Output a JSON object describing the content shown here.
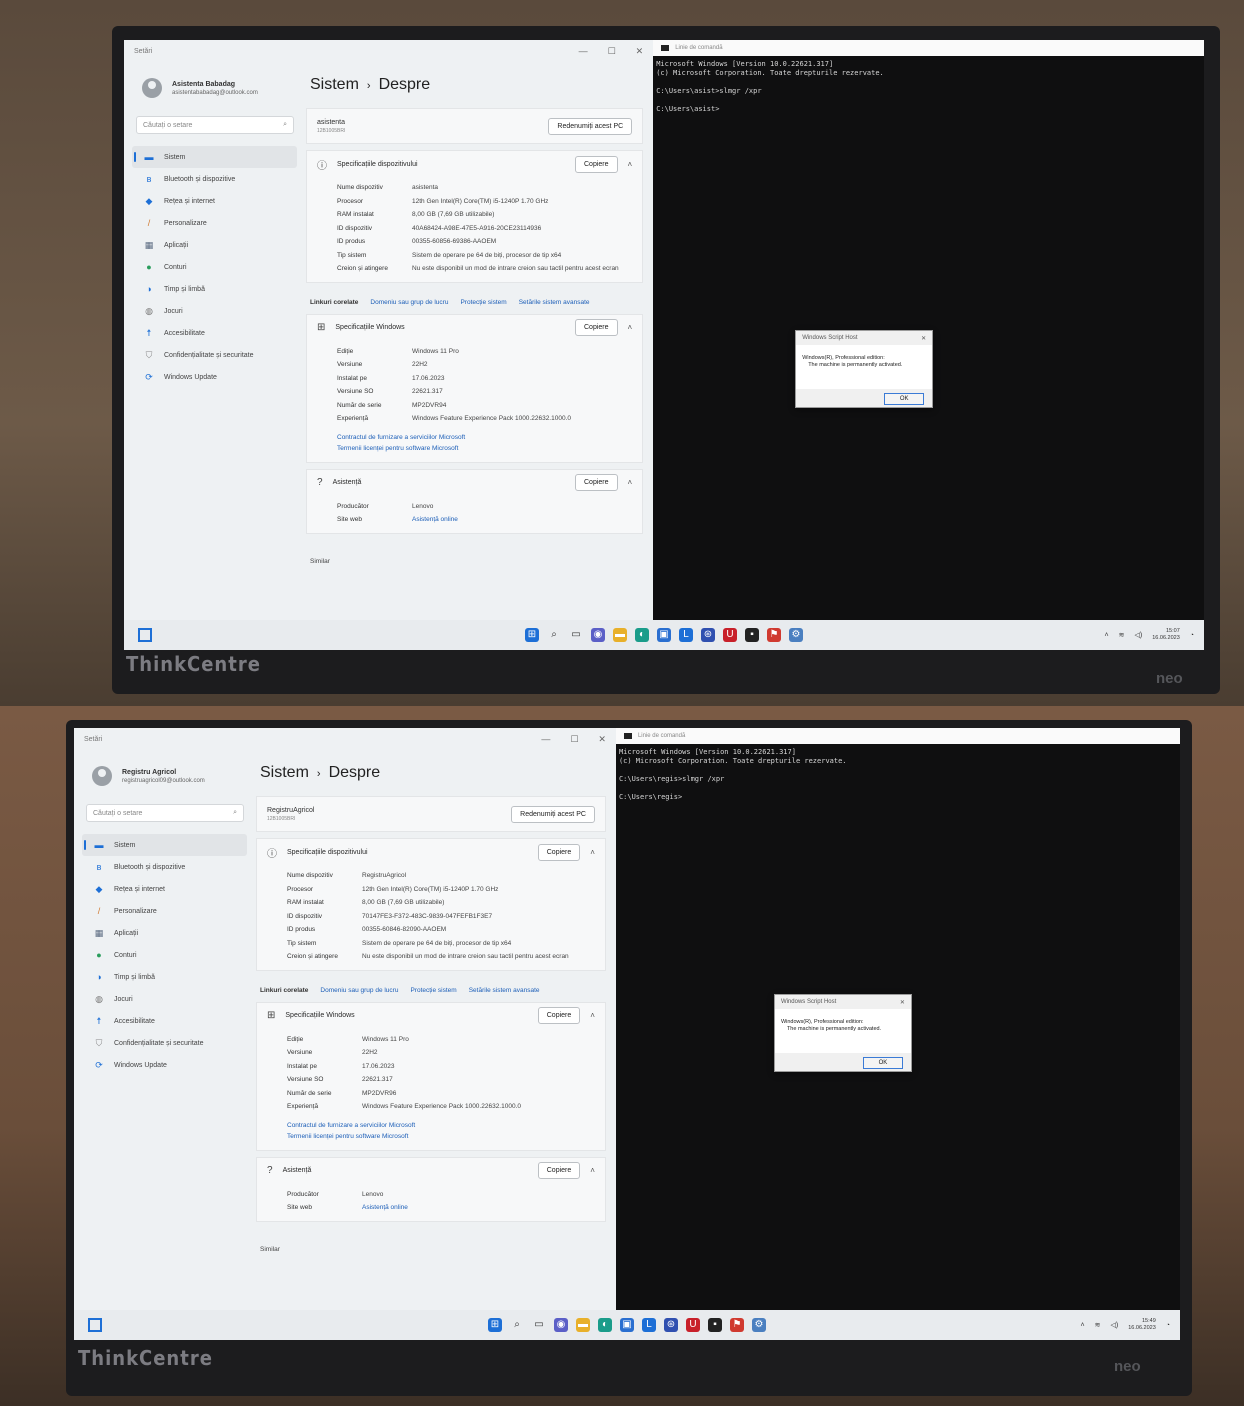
{
  "shots": [
    {
      "id": "top",
      "brand": "ThinkCentre",
      "neo": "neo",
      "settings": {
        "window_title": "Setări",
        "user_name": "Asistenta Babadag",
        "user_email": "asistentababadag@outlook.com",
        "search_placeholder": "Căutați o setare",
        "nav": [
          {
            "label": "Sistem",
            "icon": "monitor-icon",
            "selected": true
          },
          {
            "label": "Bluetooth și dispozitive",
            "icon": "bluetooth-icon"
          },
          {
            "label": "Rețea și internet",
            "icon": "wifi-icon"
          },
          {
            "label": "Personalizare",
            "icon": "brush-icon"
          },
          {
            "label": "Aplicații",
            "icon": "apps-icon"
          },
          {
            "label": "Conturi",
            "icon": "person-icon"
          },
          {
            "label": "Timp și limbă",
            "icon": "globe-icon"
          },
          {
            "label": "Jocuri",
            "icon": "gamepad-icon"
          },
          {
            "label": "Accesibilitate",
            "icon": "accessibility-icon"
          },
          {
            "label": "Confidențialitate și securitate",
            "icon": "shield-icon"
          },
          {
            "label": "Windows Update",
            "icon": "update-icon"
          }
        ],
        "breadcrumb_parent": "Sistem",
        "breadcrumb_current": "Despre",
        "pc_name": "asistenta",
        "pc_model": "12B1005BRI",
        "rename_button": "Redenumiți acest PC",
        "device_specs_title": "Specificațiile dispozitivului",
        "copy_label": "Copiere",
        "device_specs": [
          {
            "k": "Nume dispozitiv",
            "v": "asistenta"
          },
          {
            "k": "Procesor",
            "v": "12th Gen Intel(R) Core(TM) i5-1240P   1.70 GHz"
          },
          {
            "k": "RAM instalat",
            "v": "8,00 GB (7,69 GB utilizabile)"
          },
          {
            "k": "ID dispozitiv",
            "v": "40A68424-A98E-47E5-A916-20CE23114936"
          },
          {
            "k": "ID produs",
            "v": "00355-60856-69386-AAOEM"
          },
          {
            "k": "Tip sistem",
            "v": "Sistem de operare pe 64 de biți, procesor de tip x64"
          },
          {
            "k": "Creion și atingere",
            "v": "Nu este disponibil un mod de intrare creion sau tactil pentru acest ecran"
          }
        ],
        "related_title": "Linkuri corelate",
        "related_links": [
          "Domeniu sau grup de lucru",
          "Protecție sistem",
          "Setările sistem avansate"
        ],
        "windows_specs_title": "Specificațiile Windows",
        "windows_specs": [
          {
            "k": "Ediție",
            "v": "Windows 11 Pro"
          },
          {
            "k": "Versiune",
            "v": "22H2"
          },
          {
            "k": "Instalat pe",
            "v": "17.06.2023"
          },
          {
            "k": "Versiune SO",
            "v": "22621.317"
          },
          {
            "k": "Număr de serie",
            "v": "MP2DVR94"
          },
          {
            "k": "Experiență",
            "v": "Windows Feature Experience Pack 1000.22632.1000.0"
          }
        ],
        "windows_links": [
          "Contractul de furnizare a serviciilor Microsoft",
          "Termenii licenței pentru software Microsoft"
        ],
        "support_title": "Asistență",
        "support": [
          {
            "k": "Producător",
            "v": "Lenovo"
          },
          {
            "k": "Site web",
            "v": "Asistență online",
            "link": true
          }
        ],
        "similar": "Similar"
      },
      "console": {
        "title": "Linie de comandă",
        "lines": [
          "Microsoft Windows [Version 10.0.22621.317]",
          "(c) Microsoft Corporation. Toate drepturile rezervate.",
          "",
          "C:\\Users\\asist>slmgr /xpr",
          "",
          "C:\\Users\\asist>"
        ],
        "dialog_title": "Windows Script Host",
        "dialog_line1": "Windows(R), Professional edition:",
        "dialog_line2": "The machine is permanently activated.",
        "dialog_ok": "OK"
      },
      "clock": {
        "time": "15:07",
        "date": "16.06.2023"
      }
    },
    {
      "id": "bottom",
      "brand": "ThinkCentre",
      "neo": "neo",
      "settings": {
        "window_title": "Setări",
        "user_name": "Registru Agricol",
        "user_email": "registruagricol09@outlook.com",
        "search_placeholder": "Căutați o setare",
        "nav": [
          {
            "label": "Sistem",
            "icon": "monitor-icon",
            "selected": true
          },
          {
            "label": "Bluetooth și dispozitive",
            "icon": "bluetooth-icon"
          },
          {
            "label": "Rețea și internet",
            "icon": "wifi-icon"
          },
          {
            "label": "Personalizare",
            "icon": "brush-icon"
          },
          {
            "label": "Aplicații",
            "icon": "apps-icon"
          },
          {
            "label": "Conturi",
            "icon": "person-icon"
          },
          {
            "label": "Timp și limbă",
            "icon": "globe-icon"
          },
          {
            "label": "Jocuri",
            "icon": "gamepad-icon"
          },
          {
            "label": "Accesibilitate",
            "icon": "accessibility-icon"
          },
          {
            "label": "Confidențialitate și securitate",
            "icon": "shield-icon"
          },
          {
            "label": "Windows Update",
            "icon": "update-icon"
          }
        ],
        "breadcrumb_parent": "Sistem",
        "breadcrumb_current": "Despre",
        "pc_name": "RegistruAgricol",
        "pc_model": "12B1005BRI",
        "rename_button": "Redenumiți acest PC",
        "device_specs_title": "Specificațiile dispozitivului",
        "copy_label": "Copiere",
        "device_specs": [
          {
            "k": "Nume dispozitiv",
            "v": "RegistruAgricol"
          },
          {
            "k": "Procesor",
            "v": "12th Gen Intel(R) Core(TM) i5-1240P   1.70 GHz"
          },
          {
            "k": "RAM instalat",
            "v": "8,00 GB (7,69 GB utilizabile)"
          },
          {
            "k": "ID dispozitiv",
            "v": "70147FE3-F372-483C-9839-047FEFB1F3E7"
          },
          {
            "k": "ID produs",
            "v": "00355-60846-82090-AAOEM"
          },
          {
            "k": "Tip sistem",
            "v": "Sistem de operare pe 64 de biți, procesor de tip x64"
          },
          {
            "k": "Creion și atingere",
            "v": "Nu este disponibil un mod de intrare creion sau tactil pentru acest ecran"
          }
        ],
        "related_title": "Linkuri corelate",
        "related_links": [
          "Domeniu sau grup de lucru",
          "Protecție sistem",
          "Setările sistem avansate"
        ],
        "windows_specs_title": "Specificațiile Windows",
        "windows_specs": [
          {
            "k": "Ediție",
            "v": "Windows 11 Pro"
          },
          {
            "k": "Versiune",
            "v": "22H2"
          },
          {
            "k": "Instalat pe",
            "v": "17.06.2023"
          },
          {
            "k": "Versiune SO",
            "v": "22621.317"
          },
          {
            "k": "Număr de serie",
            "v": "MP2DVR96"
          },
          {
            "k": "Experiență",
            "v": "Windows Feature Experience Pack 1000.22632.1000.0"
          }
        ],
        "windows_links": [
          "Contractul de furnizare a serviciilor Microsoft",
          "Termenii licenței pentru software Microsoft"
        ],
        "support_title": "Asistență",
        "support": [
          {
            "k": "Producător",
            "v": "Lenovo"
          },
          {
            "k": "Site web",
            "v": "Asistență online",
            "link": true
          }
        ],
        "similar": "Similar"
      },
      "console": {
        "title": "Linie de comandă",
        "lines": [
          "Microsoft Windows [Version 10.0.22621.317]",
          "(c) Microsoft Corporation. Toate drepturile rezervate.",
          "",
          "C:\\Users\\regis>slmgr /xpr",
          "",
          "C:\\Users\\regis>"
        ],
        "dialog_title": "Windows Script Host",
        "dialog_line1": "Windows(R), Professional edition:",
        "dialog_line2": "The machine is permanently activated.",
        "dialog_ok": "OK"
      },
      "clock": {
        "time": "15:49",
        "date": "16.06.2023"
      }
    }
  ],
  "taskbar_icons": [
    {
      "name": "start-icon",
      "glyph": "⊞",
      "color": "#1d6fd6"
    },
    {
      "name": "search-icon",
      "glyph": "⌕",
      "color": "#333333"
    },
    {
      "name": "task-view-icon",
      "glyph": "▭",
      "color": "#333333"
    },
    {
      "name": "chat-icon",
      "glyph": "◉",
      "color": "#5b5fc7"
    },
    {
      "name": "file-explorer-icon",
      "glyph": "▬",
      "color": "#e8b02a"
    },
    {
      "name": "edge-icon",
      "glyph": "◐",
      "color": "#1a9c8a"
    },
    {
      "name": "store-icon",
      "glyph": "▣",
      "color": "#2a6fd0"
    },
    {
      "name": "app-l-icon",
      "glyph": "L",
      "color": "#1d6fd6"
    },
    {
      "name": "app-a-icon",
      "glyph": "⊛",
      "color": "#3050b0"
    },
    {
      "name": "mcafee-icon",
      "glyph": "U",
      "color": "#c8202a"
    },
    {
      "name": "terminal-icon",
      "glyph": "▪",
      "color": "#222222"
    },
    {
      "name": "app-flag-icon",
      "glyph": "⚑",
      "color": "#d03a30"
    },
    {
      "name": "settings-icon",
      "glyph": "⚙",
      "color": "#4a7fc0"
    }
  ]
}
